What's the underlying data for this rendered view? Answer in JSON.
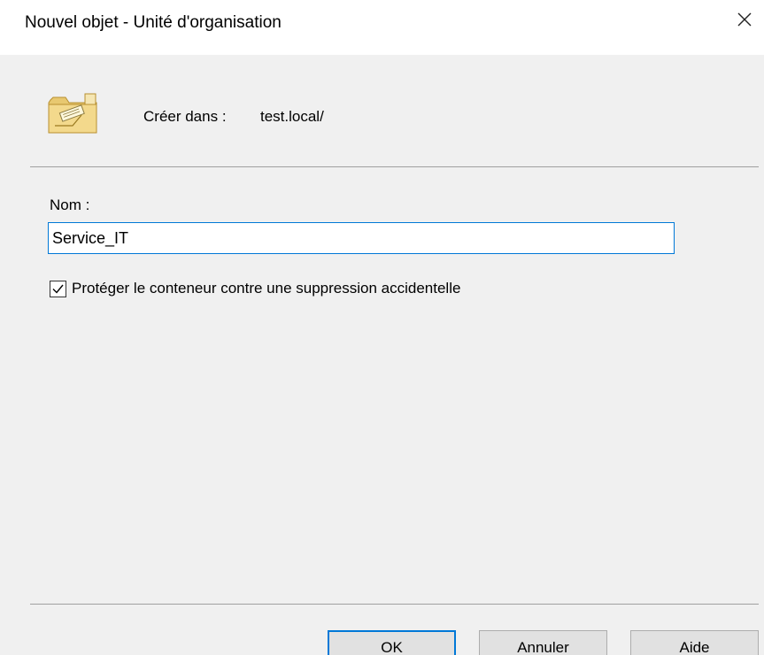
{
  "window": {
    "title": "Nouvel objet - Unité d'organisation"
  },
  "header": {
    "icon": "organizational-unit-folder-icon",
    "create_in_label": "Créer dans :",
    "create_in_value": "test.local/"
  },
  "form": {
    "name_label": "Nom :",
    "name_value": "Service_IT",
    "protect_checkbox": {
      "label": "Protéger le conteneur contre une suppression accidentelle",
      "checked": true
    }
  },
  "buttons": {
    "ok": "OK",
    "cancel": "Annuler",
    "help": "Aide"
  },
  "colors": {
    "accent": "#0078d7",
    "background": "#f0f0f0"
  }
}
